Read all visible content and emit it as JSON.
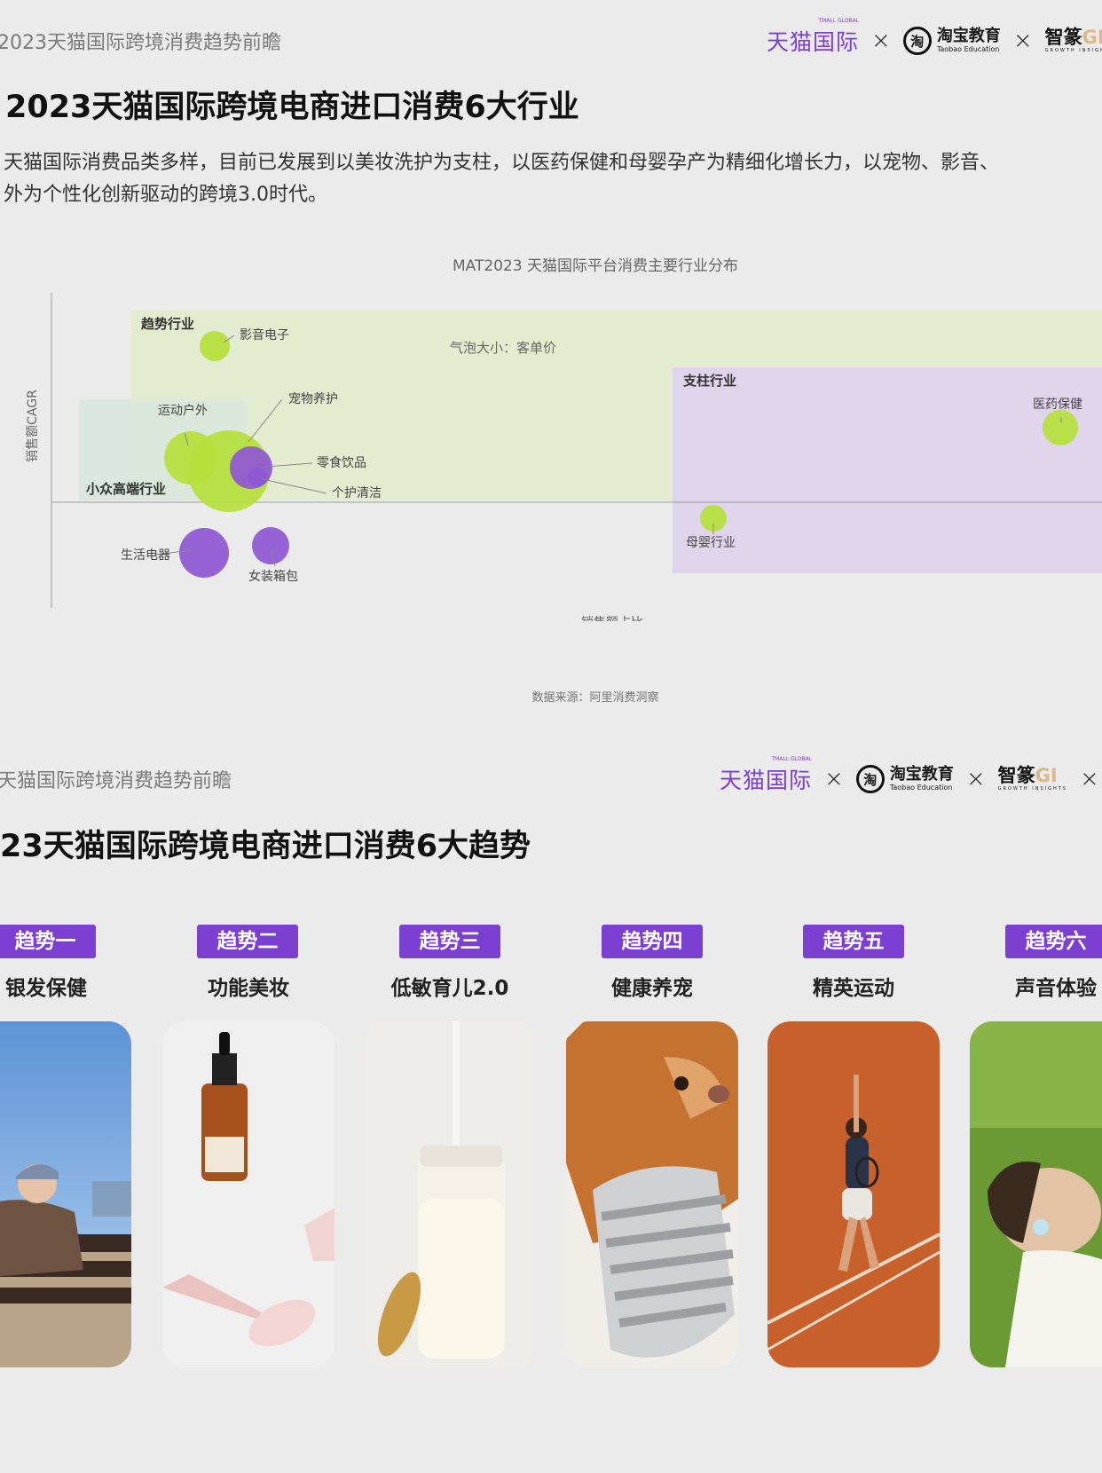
{
  "section1": {
    "header_text": "2023天猫国际跨境消费趋势前瞻",
    "title": "2023天猫国际跨境电商进口消费6大行业",
    "desc_line1": "天猫国际消费品类多样，目前已发展到以美妆洗护为支柱，以医药保健和母婴孕产为精细化增长力，以宠物、影音、",
    "desc_line2": "外为个性化创新驱动的跨境3.0时代。",
    "source": "数据来源：阿里消费洞察"
  },
  "logos": {
    "tmall": "天猫国际",
    "tmall_sub": "TMALL GLOBAL",
    "x": "×",
    "taobao_cn": "淘宝教育",
    "taobao_en": "Taobao Education",
    "taobao_mark": "淘",
    "gi_main": "智篆",
    "gi_g": "GI",
    "gi_sub": "GROWTH INSIGHTS"
  },
  "chart_data": {
    "type": "scatter",
    "title": "MAT2023 天猫国际平台消费主要行业分布",
    "xlabel": "销售额占比",
    "ylabel": "销售额CAGR",
    "size_note": "气泡大小：客单价",
    "regions": [
      {
        "label": "趋势行业",
        "color": "#e4eccf"
      },
      {
        "label": "支柱行业",
        "color": "#e0d4ec"
      },
      {
        "label": "小众高端行业",
        "color": "#d8e6dc"
      }
    ],
    "points": [
      {
        "label": "影音电子",
        "color": "#b5e03b"
      },
      {
        "label": "运动户外",
        "color": "#b5e03b"
      },
      {
        "label": "宠物养护",
        "color": "#b5e03b"
      },
      {
        "label": "零食饮品",
        "color": "#8e57d4"
      },
      {
        "label": "个护清洁",
        "color": "#8e57d4"
      },
      {
        "label": "生活电器",
        "color": "#8e57d4"
      },
      {
        "label": "女装箱包",
        "color": "#8e57d4"
      },
      {
        "label": "医药保健",
        "color": "#b5e03b"
      },
      {
        "label": "母婴行业",
        "color": "#b5e03b"
      }
    ]
  },
  "section2": {
    "header_text": "天猫国际跨境消费趋势前瞻",
    "title": "23天猫国际跨境电商进口消费6大趋势",
    "trends": [
      {
        "tag": "趋势一",
        "name": "银发保健"
      },
      {
        "tag": "趋势二",
        "name": "功能美妆"
      },
      {
        "tag": "趋势三",
        "name": "低敏育儿2.0"
      },
      {
        "tag": "趋势四",
        "name": "健康养宠"
      },
      {
        "tag": "趋势五",
        "name": "精英运动"
      },
      {
        "tag": "趋势六",
        "name": "声音体验"
      }
    ]
  },
  "colors": {
    "accent": "#7b3fd1",
    "green": "#b5e03b",
    "purple": "#8e57d4"
  }
}
